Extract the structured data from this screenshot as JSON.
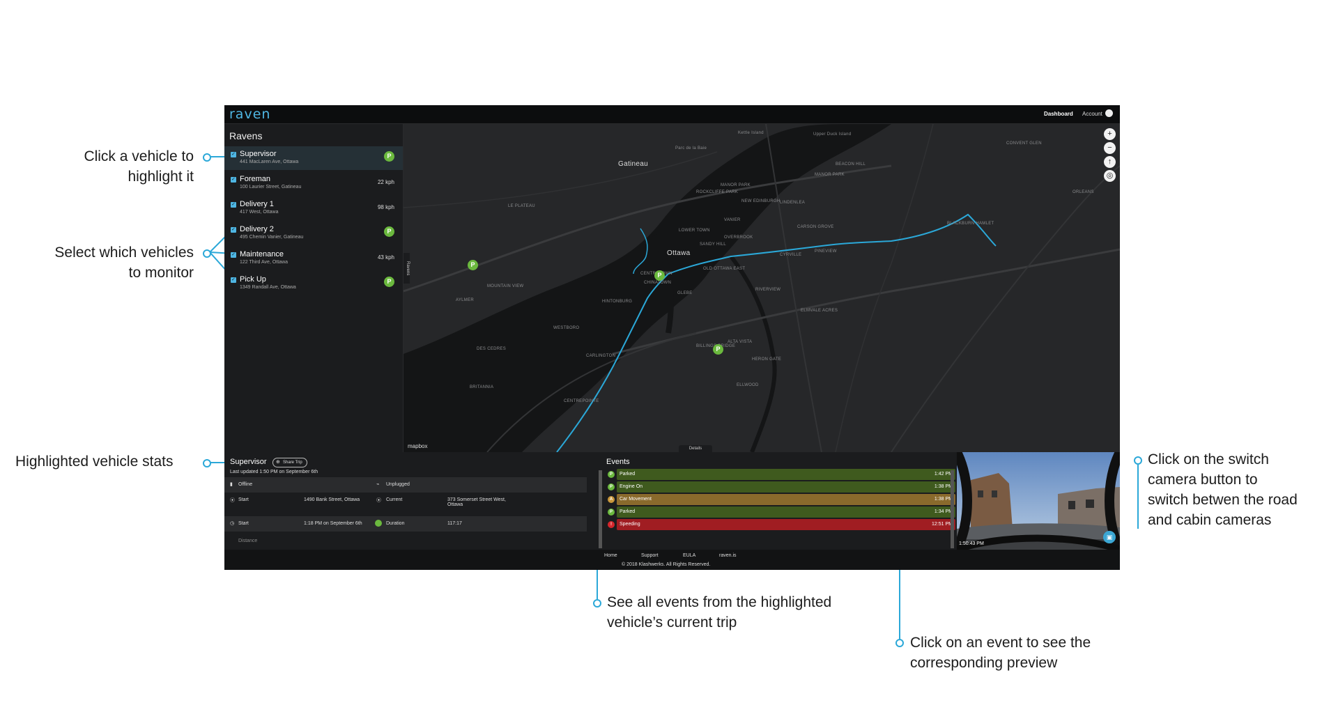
{
  "annotations": {
    "click_vehicle": [
      "Click a vehicle to",
      "highlight it"
    ],
    "select_vehicles": [
      "Select which vehicles",
      "to monitor"
    ],
    "vehicle_stats": "Highlighted vehicle stats",
    "switch_camera": [
      "Click on the switch",
      "camera button to",
      "switch betwen the road",
      "and cabin cameras"
    ],
    "see_events": [
      "See all events from the highlighted",
      "vehicle’s current trip"
    ],
    "click_event": [
      "Click on an event to see the",
      "corresponding preview"
    ]
  },
  "app": {
    "logo": "raven",
    "nav": {
      "dashboard": "Dashboard",
      "account": "Account"
    }
  },
  "sidebar": {
    "title": "Ravens",
    "vehicles": [
      {
        "name": "Supervisor",
        "address": "441 MacLaren Ave, Ottawa",
        "status": "P",
        "speed": ""
      },
      {
        "name": "Foreman",
        "address": "100 Laurier Street, Gatineau",
        "status": "",
        "speed": "22 kph"
      },
      {
        "name": "Delivery 1",
        "address": "417 West, Ottawa",
        "status": "",
        "speed": "98 kph"
      },
      {
        "name": "Delivery 2",
        "address": "495 Chemin Vanier, Gatineau",
        "status": "P",
        "speed": ""
      },
      {
        "name": "Maintenance",
        "address": "122 Third Ave, Ottawa",
        "status": "",
        "speed": "43 kph"
      },
      {
        "name": "Pick Up",
        "address": "1349 Randall Ave, Ottawa",
        "status": "P",
        "speed": ""
      }
    ]
  },
  "map": {
    "city_labels": [
      "Gatineau",
      "Ottawa"
    ],
    "area_labels": [
      "Kettle Island",
      "Upper Duck Island",
      "Parc de la Baie",
      "ROCKCLIFFE PARK",
      "MANOR PARK",
      "BEACON HILL",
      "VANIER",
      "OVERBROOK",
      "CARSON GROVE",
      "CYRVILLE",
      "LOWER TOWN",
      "SANDY HILL",
      "CENTRETOWN",
      "GLEBE",
      "HINTONBURG",
      "WESTBORO",
      "CARLINGTON",
      "ALTA VISTA",
      "BILLINGS BRIDGE",
      "BRITANNIA",
      "BLACKBURN HAMLET",
      "PINEVIEW",
      "AYLMER",
      "LE PLATEAU",
      "MANOR PARK",
      "CHINATOWN",
      "OLD OTTAWA EAST",
      "RIVERVIEW",
      "ELMVALE ACRES",
      "MOUNTAIN VIEW",
      "DES CEDRES",
      "HERON GATE",
      "ELLWOOD",
      "CENTREPOINTE",
      "NEW EDINBURGH",
      "LINDENLEA",
      "CONVENT GLEN",
      "ORLEANS"
    ],
    "controls": [
      "+",
      "−",
      "↑",
      "◎"
    ],
    "attribution": "mapbox",
    "details_tab": "Details",
    "ravens_tab": "Ravens"
  },
  "stats": {
    "title": "Supervisor",
    "share_label": "Share Trip",
    "updated": "Last updated 1:50 PM on September 6th",
    "rows": [
      {
        "l1": "Offline",
        "v1": "",
        "l2": "Unplugged",
        "v2": ""
      },
      {
        "l1": "Start",
        "v1": "1490 Bank Street, Ottawa",
        "l2": "Current",
        "v2": "373 Somerset Street West, Ottawa"
      },
      {
        "l1": "Start",
        "v1": "1:18 PM on September 6th",
        "l2": "Duration",
        "v2": "117:17"
      }
    ],
    "partial_row": "Distance"
  },
  "events": {
    "title": "Events",
    "items": [
      {
        "icon": "P",
        "label": "Parked",
        "time": "1:42 PM",
        "color": "#3f5a1e",
        "icon_color": "#6bb93e"
      },
      {
        "icon": "P",
        "label": "Engine On",
        "time": "1:38 PM",
        "color": "#3f5a1e",
        "icon_color": "#6bb93e"
      },
      {
        "icon": "A",
        "label": "Car Movement",
        "time": "1:38 PM",
        "color": "#8a6a2c",
        "icon_color": "#c9973b"
      },
      {
        "icon": "P",
        "label": "Parked",
        "time": "1:34 PM",
        "color": "#3f5a1e",
        "icon_color": "#6bb93e"
      },
      {
        "icon": "!",
        "label": "Speeding",
        "time": "12:51 PM",
        "color": "#a01d22",
        "icon_color": "#d6262c"
      }
    ]
  },
  "preview": {
    "timestamp": "1:50:43 PM"
  },
  "footer": {
    "links": [
      "Home",
      "Support",
      "EULA",
      "raven.is"
    ],
    "copyright": "© 2018 Klashwerks. All Rights Reserved."
  },
  "colors": {
    "accent": "#2ba8d8",
    "parked": "#6bb93e",
    "speeding": "#a01d22",
    "movement": "#8a6a2c"
  }
}
